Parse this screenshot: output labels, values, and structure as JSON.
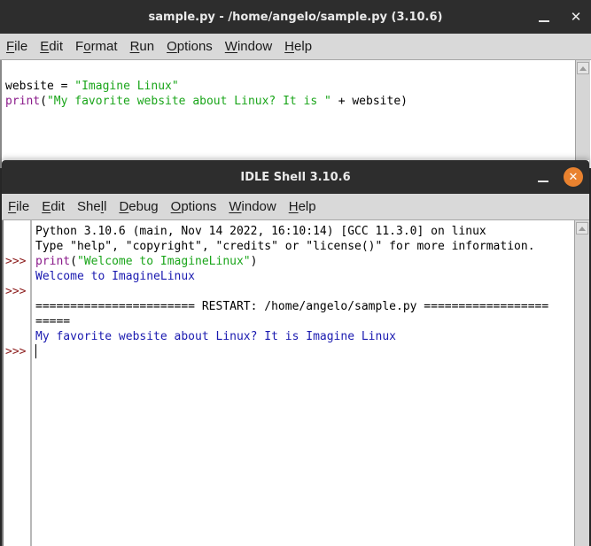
{
  "editor": {
    "title": "sample.py - /home/angelo/sample.py (3.10.6)",
    "menu": [
      {
        "pre": "",
        "u": "F",
        "post": "ile"
      },
      {
        "pre": "",
        "u": "E",
        "post": "dit"
      },
      {
        "pre": "F",
        "u": "o",
        "post": "rmat"
      },
      {
        "pre": "",
        "u": "R",
        "post": "un"
      },
      {
        "pre": "",
        "u": "O",
        "post": "ptions"
      },
      {
        "pre": "",
        "u": "W",
        "post": "indow"
      },
      {
        "pre": "",
        "u": "H",
        "post": "elp"
      }
    ],
    "code": {
      "line1_var": "website = ",
      "line1_str": "\"Imagine Linux\"",
      "line2_kw": "print",
      "line2_open": "(",
      "line2_str": "\"My favorite website about Linux? It is \"",
      "line2_rest": " + website)"
    }
  },
  "shell": {
    "title": "IDLE Shell 3.10.6",
    "menu": [
      {
        "pre": "",
        "u": "F",
        "post": "ile"
      },
      {
        "pre": "",
        "u": "E",
        "post": "dit"
      },
      {
        "pre": "She",
        "u": "l",
        "post": "l"
      },
      {
        "pre": "",
        "u": "D",
        "post": "ebug"
      },
      {
        "pre": "",
        "u": "O",
        "post": "ptions"
      },
      {
        "pre": "",
        "u": "W",
        "post": "indow"
      },
      {
        "pre": "",
        "u": "H",
        "post": "elp"
      }
    ],
    "prompt": ">>>",
    "lines": {
      "banner1": "Python 3.10.6 (main, Nov 14 2022, 16:10:14) [GCC 11.3.0] on linux",
      "banner2": "Type \"help\", \"copyright\", \"credits\" or \"license()\" for more information.",
      "cmd_kw": "print",
      "cmd_open": "(",
      "cmd_str": "\"Welcome to ImagineLinux\"",
      "cmd_close": ")",
      "output1": "Welcome to ImagineLinux",
      "restart1": "======================= RESTART: /home/angelo/sample.py ==================",
      "restart2": "=====",
      "output2": "My favorite website about Linux? It is Imagine Linux"
    }
  },
  "colors": {
    "close_button_active": "#e9822f",
    "titlebar": "#2d2d2d"
  }
}
